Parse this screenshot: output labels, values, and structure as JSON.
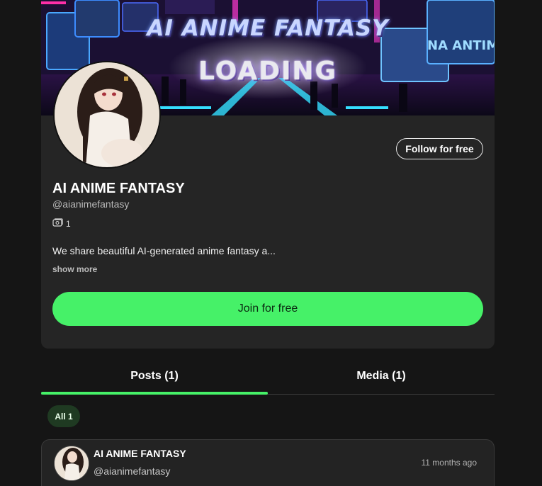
{
  "banner": {
    "title": "AI ANIME FANTASY",
    "subtitle": "LOADING",
    "side_sign": "NA ANTIMY"
  },
  "profile": {
    "name": "AI ANIME FANTASY",
    "handle": "@aianimefantasy",
    "media_count": "1",
    "description": "We share beautiful AI-generated anime fantasy a...",
    "show_more_label": "show more",
    "follow_label": "Follow for free",
    "join_label": "Join for free"
  },
  "tabs": [
    {
      "label": "Posts (1)",
      "active": true
    },
    {
      "label": "Media (1)",
      "active": false
    }
  ],
  "filter": {
    "label": "All 1"
  },
  "post": {
    "author": "AI ANIME FANTASY",
    "handle": "@aianimefantasy",
    "time": "11 months ago"
  },
  "colors": {
    "accent": "#46f168",
    "background": "#151515",
    "card": "#252525",
    "chip": "#1f3a22"
  },
  "icons": {
    "media": "photo-stack-icon"
  }
}
